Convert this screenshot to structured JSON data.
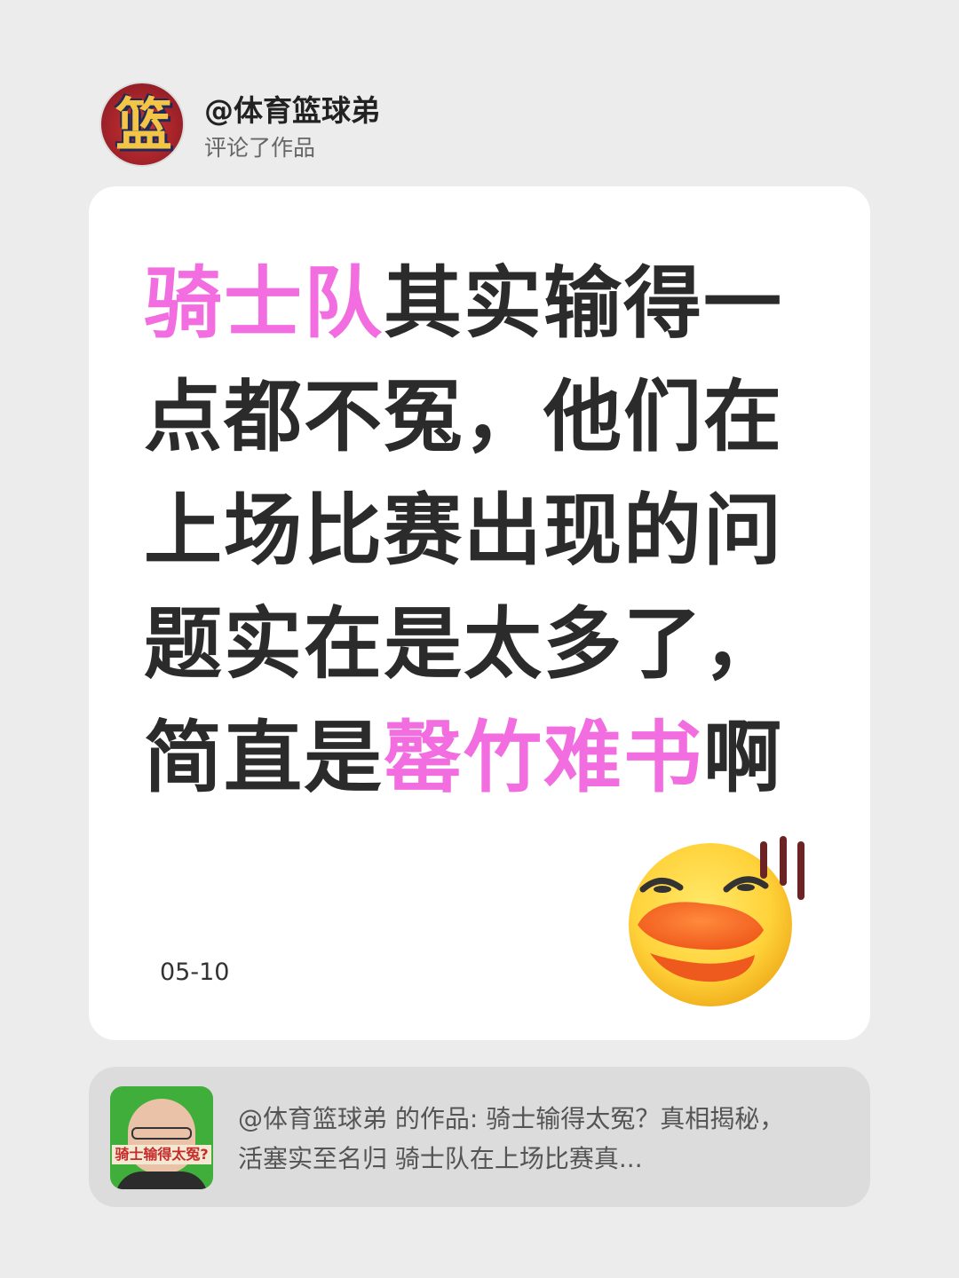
{
  "user": {
    "avatar_glyph": "篮",
    "name": "@体育篮球弟",
    "action": "评论了作品"
  },
  "comment": {
    "segments": [
      {
        "text": "骑士队",
        "highlight": true
      },
      {
        "text": "其实输得一点都不冤，他们在上场比赛出现的问题实在是太多了，简直是",
        "highlight": false
      },
      {
        "text": "罄竹难书",
        "highlight": true
      },
      {
        "text": "啊",
        "highlight": false
      }
    ],
    "date": "05-10",
    "emoji_icon": "sweating-duck-face-emoji"
  },
  "reference": {
    "thumbnail_caption": "骑士输得太冤?",
    "text": "@体育篮球弟 的作品: 骑士输得太冤？真相揭秘，活塞实至名归 骑士队在上场比赛真..."
  },
  "colors": {
    "background": "#ececec",
    "card": "#ffffff",
    "highlight": "#f26de0",
    "text": "#2b2b2b"
  }
}
